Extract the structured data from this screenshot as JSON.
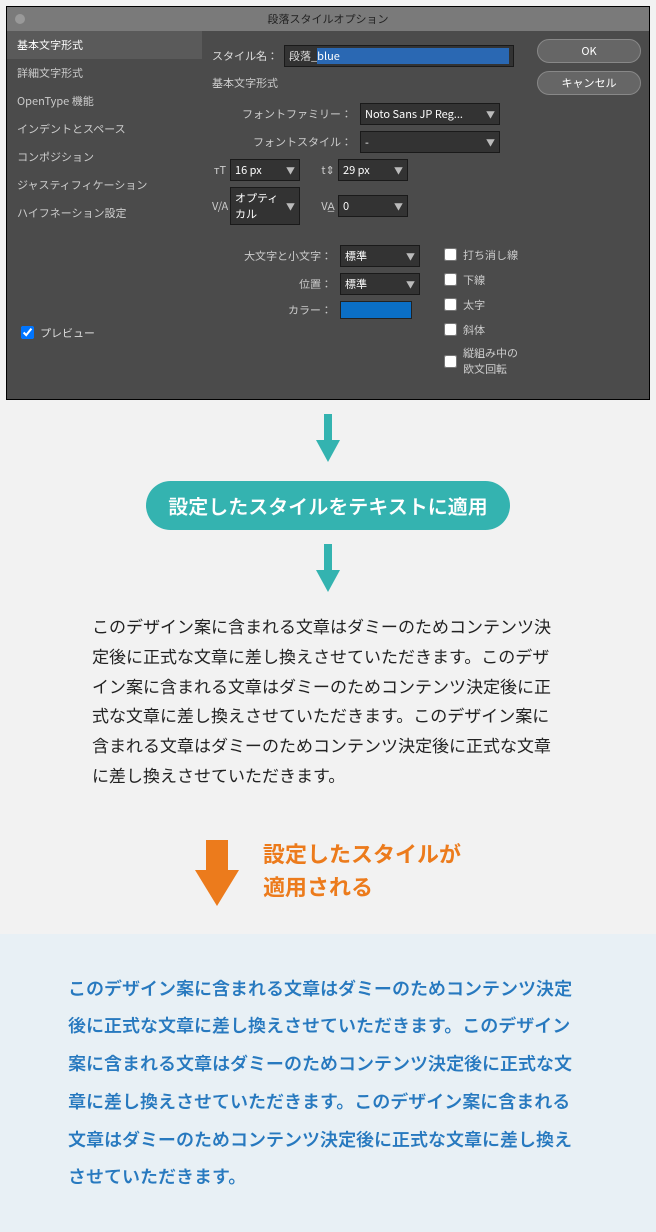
{
  "dialog": {
    "title": "段落スタイルオプション",
    "sidebar": [
      "基本文字形式",
      "詳細文字形式",
      "OpenType 機能",
      "インデントとスペース",
      "コンポジション",
      "ジャスティフィケーション",
      "ハイフネーション設定"
    ],
    "styleName": {
      "label": "スタイル名：",
      "prefix": "段落_",
      "value": "blue"
    },
    "section": "基本文字形式",
    "fontFamily": {
      "label": "フォントファミリー：",
      "value": "Noto Sans JP Reg..."
    },
    "fontStyle": {
      "label": "フォントスタイル：",
      "value": "-"
    },
    "size": {
      "value": "16 px"
    },
    "leading": {
      "value": "29 px"
    },
    "kerning": {
      "value": "オプティカル"
    },
    "tracking": {
      "value": "0"
    },
    "case": {
      "label": "大文字と小文字：",
      "value": "標準"
    },
    "position": {
      "label": "位置：",
      "value": "標準"
    },
    "color": {
      "label": "カラー：",
      "hex": "#0b6fc6"
    },
    "checks": [
      "打ち消し線",
      "下線",
      "太字",
      "斜体",
      "縦組み中の欧文回転"
    ],
    "preview": "プレビュー",
    "ok": "OK",
    "cancel": "キャンセル"
  },
  "callout1": "設定したスタイルをテキストに適用",
  "body1": "このデザイン案に含まれる文章はダミーのためコンテンツ決定後に正式な文章に差し換えさせていただきます。このデザイン案に含まれる文章はダミーのためコンテンツ決定後に正式な文章に差し換えさせていただきます。このデザイン案に含まれる文章はダミーのためコンテンツ決定後に正式な文章に差し換えさせていただきます。",
  "callout2a": "設定したスタイルが",
  "callout2b": "適用される",
  "body2": "このデザイン案に含まれる文章はダミーのためコンテンツ決定後に正式な文章に差し換えさせていただきます。このデザイン案に含まれる文章はダミーのためコンテンツ決定後に正式な文章に差し換えさせていただきます。このデザイン案に含まれる文章はダミーのためコンテンツ決定後に正式な文章に差し換えさせていただきます。"
}
